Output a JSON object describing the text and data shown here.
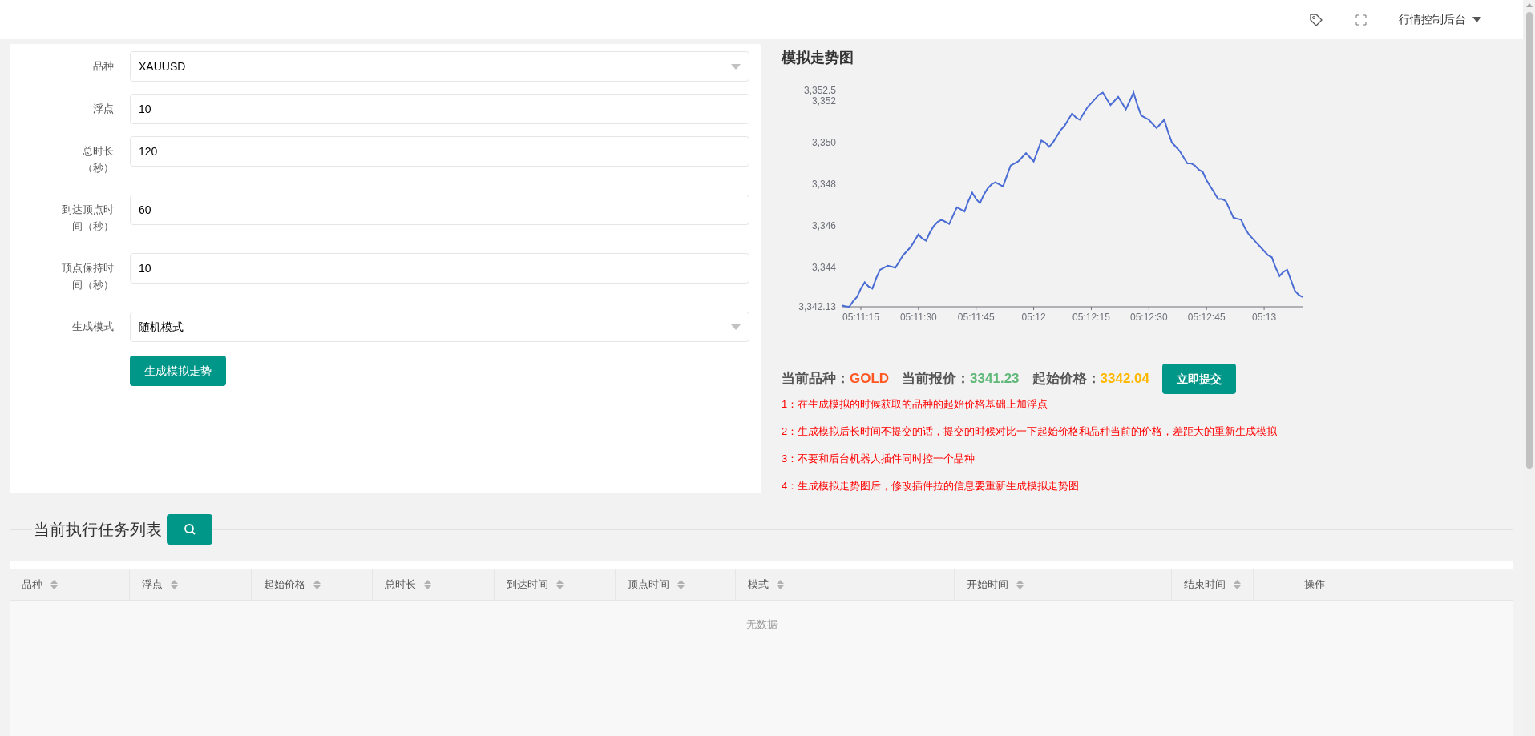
{
  "header": {
    "menu_label": "行情控制后台"
  },
  "form": {
    "fields": [
      {
        "label": "品种",
        "kind": "select",
        "value": "XAUUSD"
      },
      {
        "label": "浮点",
        "kind": "input",
        "value": "10"
      },
      {
        "label": "总时长（秒）",
        "kind": "input",
        "value": "120"
      },
      {
        "label": "到达顶点时间（秒）",
        "kind": "input",
        "value": "60"
      },
      {
        "label": "顶点保持时间（秒）",
        "kind": "input",
        "value": "10"
      },
      {
        "label": "生成模式",
        "kind": "select",
        "value": "随机模式"
      }
    ],
    "button": "生成模拟走势"
  },
  "chart": {
    "title": "模拟走势图",
    "chart_data": {
      "type": "line",
      "categories": [
        null,
        null,
        null,
        null,
        null,
        "05:11:15",
        null,
        null,
        null,
        null,
        null,
        null,
        null,
        null,
        null,
        null,
        null,
        null,
        null,
        null,
        "05:11:30",
        null,
        null,
        null,
        null,
        null,
        null,
        null,
        null,
        null,
        null,
        null,
        null,
        null,
        null,
        "05:11:45",
        null,
        null,
        null,
        null,
        null,
        null,
        null,
        null,
        null,
        null,
        null,
        null,
        null,
        null,
        "05:12",
        null,
        null,
        null,
        null,
        null,
        null,
        null,
        null,
        null,
        null,
        null,
        null,
        null,
        null,
        "05:12:15",
        null,
        null,
        null,
        null,
        null,
        null,
        null,
        null,
        null,
        null,
        null,
        null,
        null,
        null,
        "05:12:30",
        null,
        null,
        null,
        null,
        null,
        null,
        null,
        null,
        null,
        null,
        null,
        null,
        null,
        null,
        "05:12:45",
        null,
        null,
        null,
        null,
        null,
        null,
        null,
        null,
        null,
        null,
        null,
        null,
        null,
        null,
        "05:13",
        null,
        null,
        null,
        null,
        null,
        null,
        null,
        null,
        null,
        null
      ],
      "series": [
        {
          "color": "#4a6cd4",
          "values": [
            3342.2,
            3342.15,
            3342.13,
            3342.4,
            3342.6,
            3343.0,
            3343.3,
            3343.1,
            3343.0,
            3343.5,
            3343.9,
            3344.0,
            3344.1,
            3344.05,
            3344.0,
            3344.3,
            3344.6,
            3344.8,
            3345.0,
            3345.3,
            3345.6,
            3345.4,
            3345.3,
            3345.7,
            3346.0,
            3346.2,
            3346.3,
            3346.2,
            3346.1,
            3346.5,
            3346.9,
            3346.8,
            3346.7,
            3347.2,
            3347.6,
            3347.3,
            3347.1,
            3347.5,
            3347.8,
            3348.0,
            3348.1,
            3348.0,
            3347.9,
            3348.4,
            3348.9,
            3349.0,
            3349.1,
            3349.3,
            3349.5,
            3349.3,
            3349.1,
            3349.6,
            3350.1,
            3350.0,
            3349.8,
            3350.0,
            3350.3,
            3350.6,
            3350.8,
            3351.1,
            3351.4,
            3351.2,
            3351.1,
            3351.4,
            3351.7,
            3351.9,
            3352.1,
            3352.3,
            3352.4,
            3352.1,
            3351.8,
            3352.0,
            3352.2,
            3351.9,
            3351.6,
            3352.0,
            3352.4,
            3351.8,
            3351.3,
            3351.2,
            3351.1,
            3350.9,
            3350.7,
            3350.9,
            3351.1,
            3350.5,
            3350.0,
            3349.8,
            3349.6,
            3349.3,
            3349.0,
            3349.0,
            3348.9,
            3348.7,
            3348.6,
            3348.2,
            3347.9,
            3347.6,
            3347.3,
            3347.3,
            3347.2,
            3346.8,
            3346.4,
            3346.35,
            3346.3,
            3345.9,
            3345.6,
            3345.4,
            3345.2,
            3345.0,
            3344.8,
            3344.6,
            3344.5,
            3344.0,
            3343.6,
            3343.8,
            3343.9,
            3343.4,
            3342.9,
            3342.7,
            3342.6
          ]
        }
      ],
      "ylim": [
        3342.13,
        3352.5
      ],
      "yticks": [
        {
          "value": 3342.13,
          "label": "3,342.13"
        },
        {
          "value": 3344,
          "label": "3,344"
        },
        {
          "value": 3346,
          "label": "3,346"
        },
        {
          "value": 3348,
          "label": "3,348"
        },
        {
          "value": 3350,
          "label": "3,350"
        },
        {
          "value": 3352,
          "label": "3,352"
        },
        {
          "value": 3352.5,
          "label": "3,352.5"
        }
      ]
    }
  },
  "info": [
    {
      "label": "当前品种：",
      "value": "GOLD",
      "color": "#ff5722"
    },
    {
      "label": "当前报价：",
      "value": "3341.23",
      "color": "#5fb878"
    },
    {
      "label": "起始价格：",
      "value": "3342.04",
      "color": "#ffb800"
    }
  ],
  "submit_button": "立即提交",
  "notes": [
    "1：在生成模拟的时候获取的品种的起始价格基础上加浮点",
    "2：生成模拟后长时间不提交的话，提交的时候对比一下起始价格和品种当前的价格，差距大的重新生成模拟",
    "3：不要和后台机器人插件同时控一个品种",
    "4：生成模拟走势图后，修改插件拉的信息要重新生成模拟走势图"
  ],
  "tasks": {
    "title": "当前执行任务列表",
    "columns": [
      {
        "label": "品种",
        "sortable": true
      },
      {
        "label": "浮点",
        "sortable": true
      },
      {
        "label": "起始价格",
        "sortable": true
      },
      {
        "label": "总时长",
        "sortable": true
      },
      {
        "label": "到达时间",
        "sortable": true
      },
      {
        "label": "顶点时间",
        "sortable": true
      },
      {
        "label": "模式",
        "sortable": true
      },
      {
        "label": "开始时间",
        "sortable": true
      },
      {
        "label": "结束时间",
        "sortable": true
      },
      {
        "label": "操作",
        "sortable": false
      }
    ],
    "empty_text": "无数据"
  }
}
